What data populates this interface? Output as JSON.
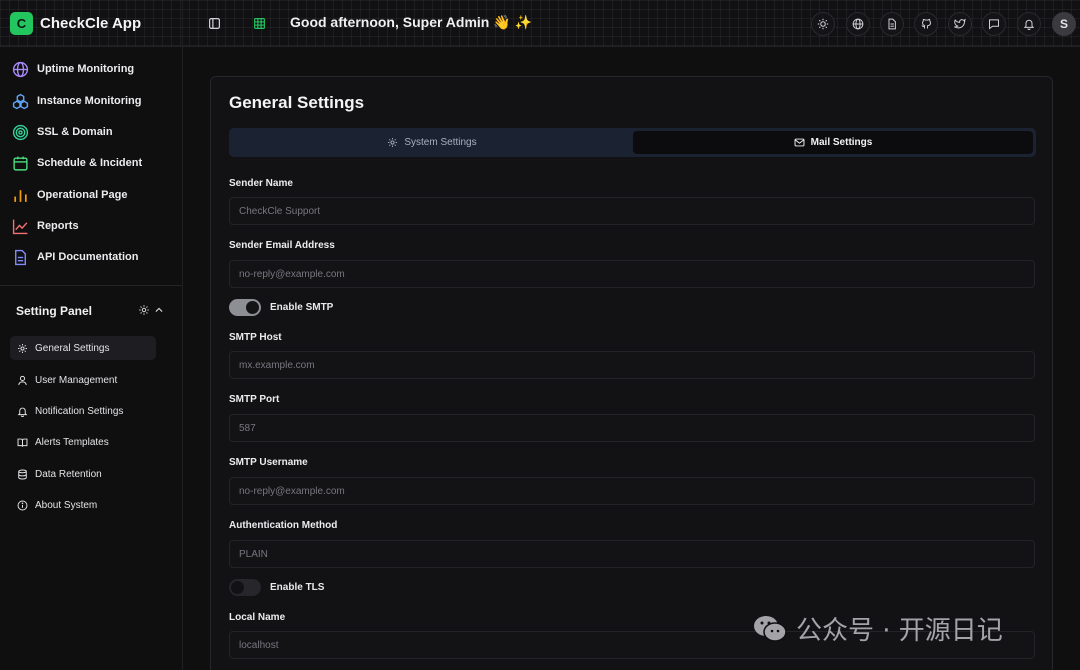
{
  "brand": {
    "logo_letter": "C",
    "name": "CheckCle App",
    "accent": "#22c55e"
  },
  "header": {
    "greeting": "Good afternoon, Super Admin 👋 ✨",
    "avatar_letter": "S",
    "actions": [
      "sun-icon",
      "globe-icon",
      "document-icon",
      "github-icon",
      "twitter-icon",
      "chat-icon",
      "bell-icon"
    ]
  },
  "sidebar": {
    "items": [
      {
        "label": "Uptime Monitoring",
        "icon": "globe-icon",
        "color": "#a78bfa"
      },
      {
        "label": "Instance Monitoring",
        "icon": "cluster-icon",
        "color": "#60a5fa"
      },
      {
        "label": "SSL & Domain",
        "icon": "target-icon",
        "color": "#34d399"
      },
      {
        "label": "Schedule & Incident",
        "icon": "calendar-icon",
        "color": "#4ade80"
      },
      {
        "label": "Operational Page",
        "icon": "bar-chart-icon",
        "color": "#f59e0b"
      },
      {
        "label": "Reports",
        "icon": "line-chart-icon",
        "color": "#f87171"
      },
      {
        "label": "API Documentation",
        "icon": "file-icon",
        "color": "#818cf8"
      }
    ],
    "panel_title": "Setting Panel",
    "settings": [
      {
        "label": "General Settings",
        "icon": "gear-icon",
        "active": true
      },
      {
        "label": "User Management",
        "icon": "user-icon",
        "active": false
      },
      {
        "label": "Notification Settings",
        "icon": "bell-icon",
        "active": false
      },
      {
        "label": "Alerts Templates",
        "icon": "book-icon",
        "active": false
      },
      {
        "label": "Data Retention",
        "icon": "database-icon",
        "active": false
      },
      {
        "label": "About System",
        "icon": "info-icon",
        "active": false
      }
    ]
  },
  "main": {
    "title": "General Settings",
    "tabs": [
      {
        "label": "System Settings",
        "active": false
      },
      {
        "label": "Mail Settings",
        "active": true
      }
    ],
    "fields": {
      "sender_name": {
        "label": "Sender Name",
        "placeholder": "CheckCle Support"
      },
      "sender_email": {
        "label": "Sender Email Address",
        "placeholder": "no-reply@example.com"
      },
      "enable_smtp": {
        "label": "Enable SMTP",
        "on": true
      },
      "smtp_host": {
        "label": "SMTP Host",
        "placeholder": "mx.example.com"
      },
      "smtp_port": {
        "label": "SMTP Port",
        "placeholder": "587"
      },
      "smtp_username": {
        "label": "SMTP Username",
        "placeholder": "no-reply@example.com"
      },
      "auth_method": {
        "label": "Authentication Method",
        "value": "PLAIN"
      },
      "enable_tls": {
        "label": "Enable TLS",
        "on": false
      },
      "local_name": {
        "label": "Local Name",
        "placeholder": "localhost"
      }
    }
  },
  "watermark": {
    "text": "公众号 · 开源日记"
  }
}
